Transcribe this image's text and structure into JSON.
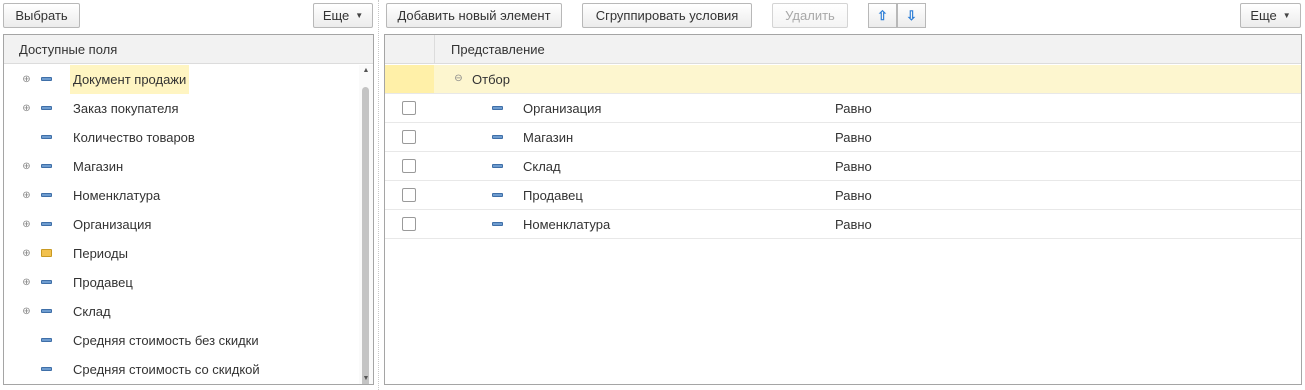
{
  "left_toolbar": {
    "select_label": "Выбрать",
    "more_label": "Еще"
  },
  "right_toolbar": {
    "add_label": "Добавить новый элемент",
    "group_label": "Сгруппировать условия",
    "delete_label": "Удалить",
    "more_label": "Еще"
  },
  "fields_panel": {
    "header": "Доступные поля",
    "items": [
      {
        "label": "Документ продажи",
        "expandable": true,
        "icon": "field-icon",
        "selected": true
      },
      {
        "label": "Заказ покупателя",
        "expandable": true,
        "icon": "field-icon"
      },
      {
        "label": "Количество товаров",
        "expandable": false,
        "icon": "field-icon"
      },
      {
        "label": "Магазин",
        "expandable": true,
        "icon": "field-icon"
      },
      {
        "label": "Номенклатура",
        "expandable": true,
        "icon": "field-icon"
      },
      {
        "label": "Организация",
        "expandable": true,
        "icon": "field-icon"
      },
      {
        "label": "Периоды",
        "expandable": true,
        "icon": "folder-icon"
      },
      {
        "label": "Продавец",
        "expandable": true,
        "icon": "field-icon"
      },
      {
        "label": "Склад",
        "expandable": true,
        "icon": "field-icon"
      },
      {
        "label": "Средняя стоимость без скидки",
        "expandable": false,
        "icon": "field-icon"
      },
      {
        "label": "Средняя стоимость со скидкой",
        "expandable": false,
        "icon": "field-icon"
      }
    ]
  },
  "filter_panel": {
    "header": "Представление",
    "group_label": "Отбор",
    "rows": [
      {
        "field": "Организация",
        "condition": "Равно"
      },
      {
        "field": "Магазин",
        "condition": "Равно"
      },
      {
        "field": "Склад",
        "condition": "Равно"
      },
      {
        "field": "Продавец",
        "condition": "Равно"
      },
      {
        "field": "Номенклатура",
        "condition": "Равно"
      }
    ]
  },
  "colors": {
    "selected_row_bg": "#fff5c2",
    "group_row_bg": "#fdf6cf",
    "field_icon": "#6e9ccf",
    "arrow_icon": "#2f7fd6"
  }
}
